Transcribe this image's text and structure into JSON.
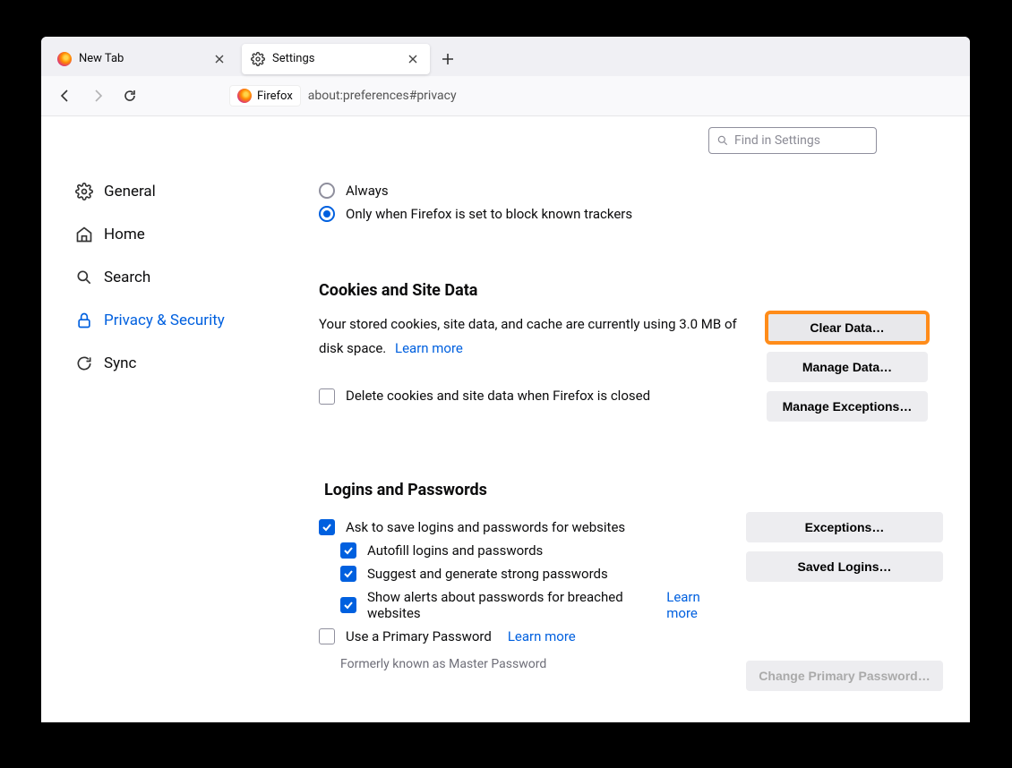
{
  "tabs": {
    "inactive_label": "New Tab",
    "active_label": "Settings"
  },
  "url": {
    "chip": "Firefox",
    "path": "about:preferences#privacy"
  },
  "search": {
    "placeholder": "Find in Settings"
  },
  "sidebar": {
    "general": "General",
    "home": "Home",
    "search": "Search",
    "privacy": "Privacy & Security",
    "sync": "Sync"
  },
  "tracker_radio": {
    "always": "Always",
    "only_block": "Only when Firefox is set to block known trackers"
  },
  "cookies": {
    "title": "Cookies and Site Data",
    "desc": "Your stored cookies, site data, and cache are currently using 3.0 MB of disk space.",
    "learn": "Learn more",
    "delete_on_close": "Delete cookies and site data when Firefox is closed",
    "clear": "Clear Data…",
    "manage": "Manage Data…",
    "exceptions": "Manage Exceptions…"
  },
  "logins": {
    "title": "Logins and Passwords",
    "ask_save": "Ask to save logins and passwords for websites",
    "autofill": "Autofill logins and passwords",
    "suggest": "Suggest and generate strong passwords",
    "breach": "Show alerts about passwords for breached websites",
    "breach_learn": "Learn more",
    "primary": "Use a Primary Password",
    "primary_learn": "Learn more",
    "note": "Formerly known as Master Password",
    "exceptions": "Exceptions…",
    "saved": "Saved Logins…",
    "change_primary": "Change Primary Password…"
  }
}
